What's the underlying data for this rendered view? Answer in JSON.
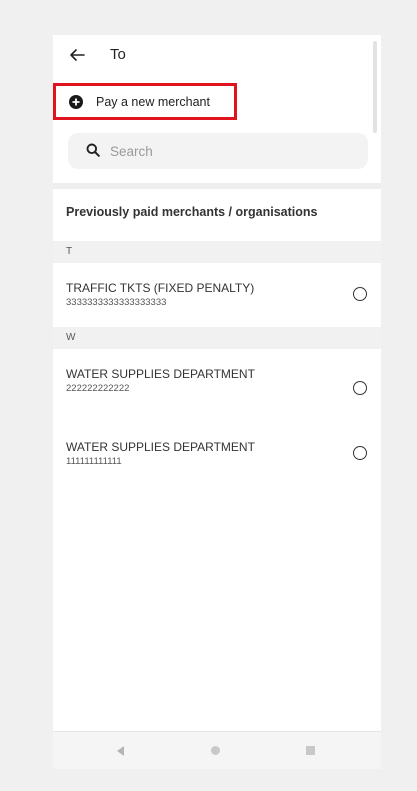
{
  "header": {
    "title": "To"
  },
  "pay_new": {
    "label": "Pay a new merchant"
  },
  "search": {
    "placeholder": "Search",
    "value": ""
  },
  "section_title": "Previously paid merchants / organisations",
  "groups": [
    {
      "letter": "T",
      "merchants": [
        {
          "name": "TRAFFIC TKTS (FIXED PENALTY)",
          "code": "3333333333333333333"
        }
      ]
    },
    {
      "letter": "W",
      "merchants": [
        {
          "name": "WATER SUPPLIES DEPARTMENT",
          "code": "222222222222"
        },
        {
          "name": "WATER SUPPLIES DEPARTMENT",
          "code": "111111111111"
        }
      ]
    }
  ],
  "colors": {
    "highlight": "#e0141e",
    "background": "#f0f0f0"
  }
}
